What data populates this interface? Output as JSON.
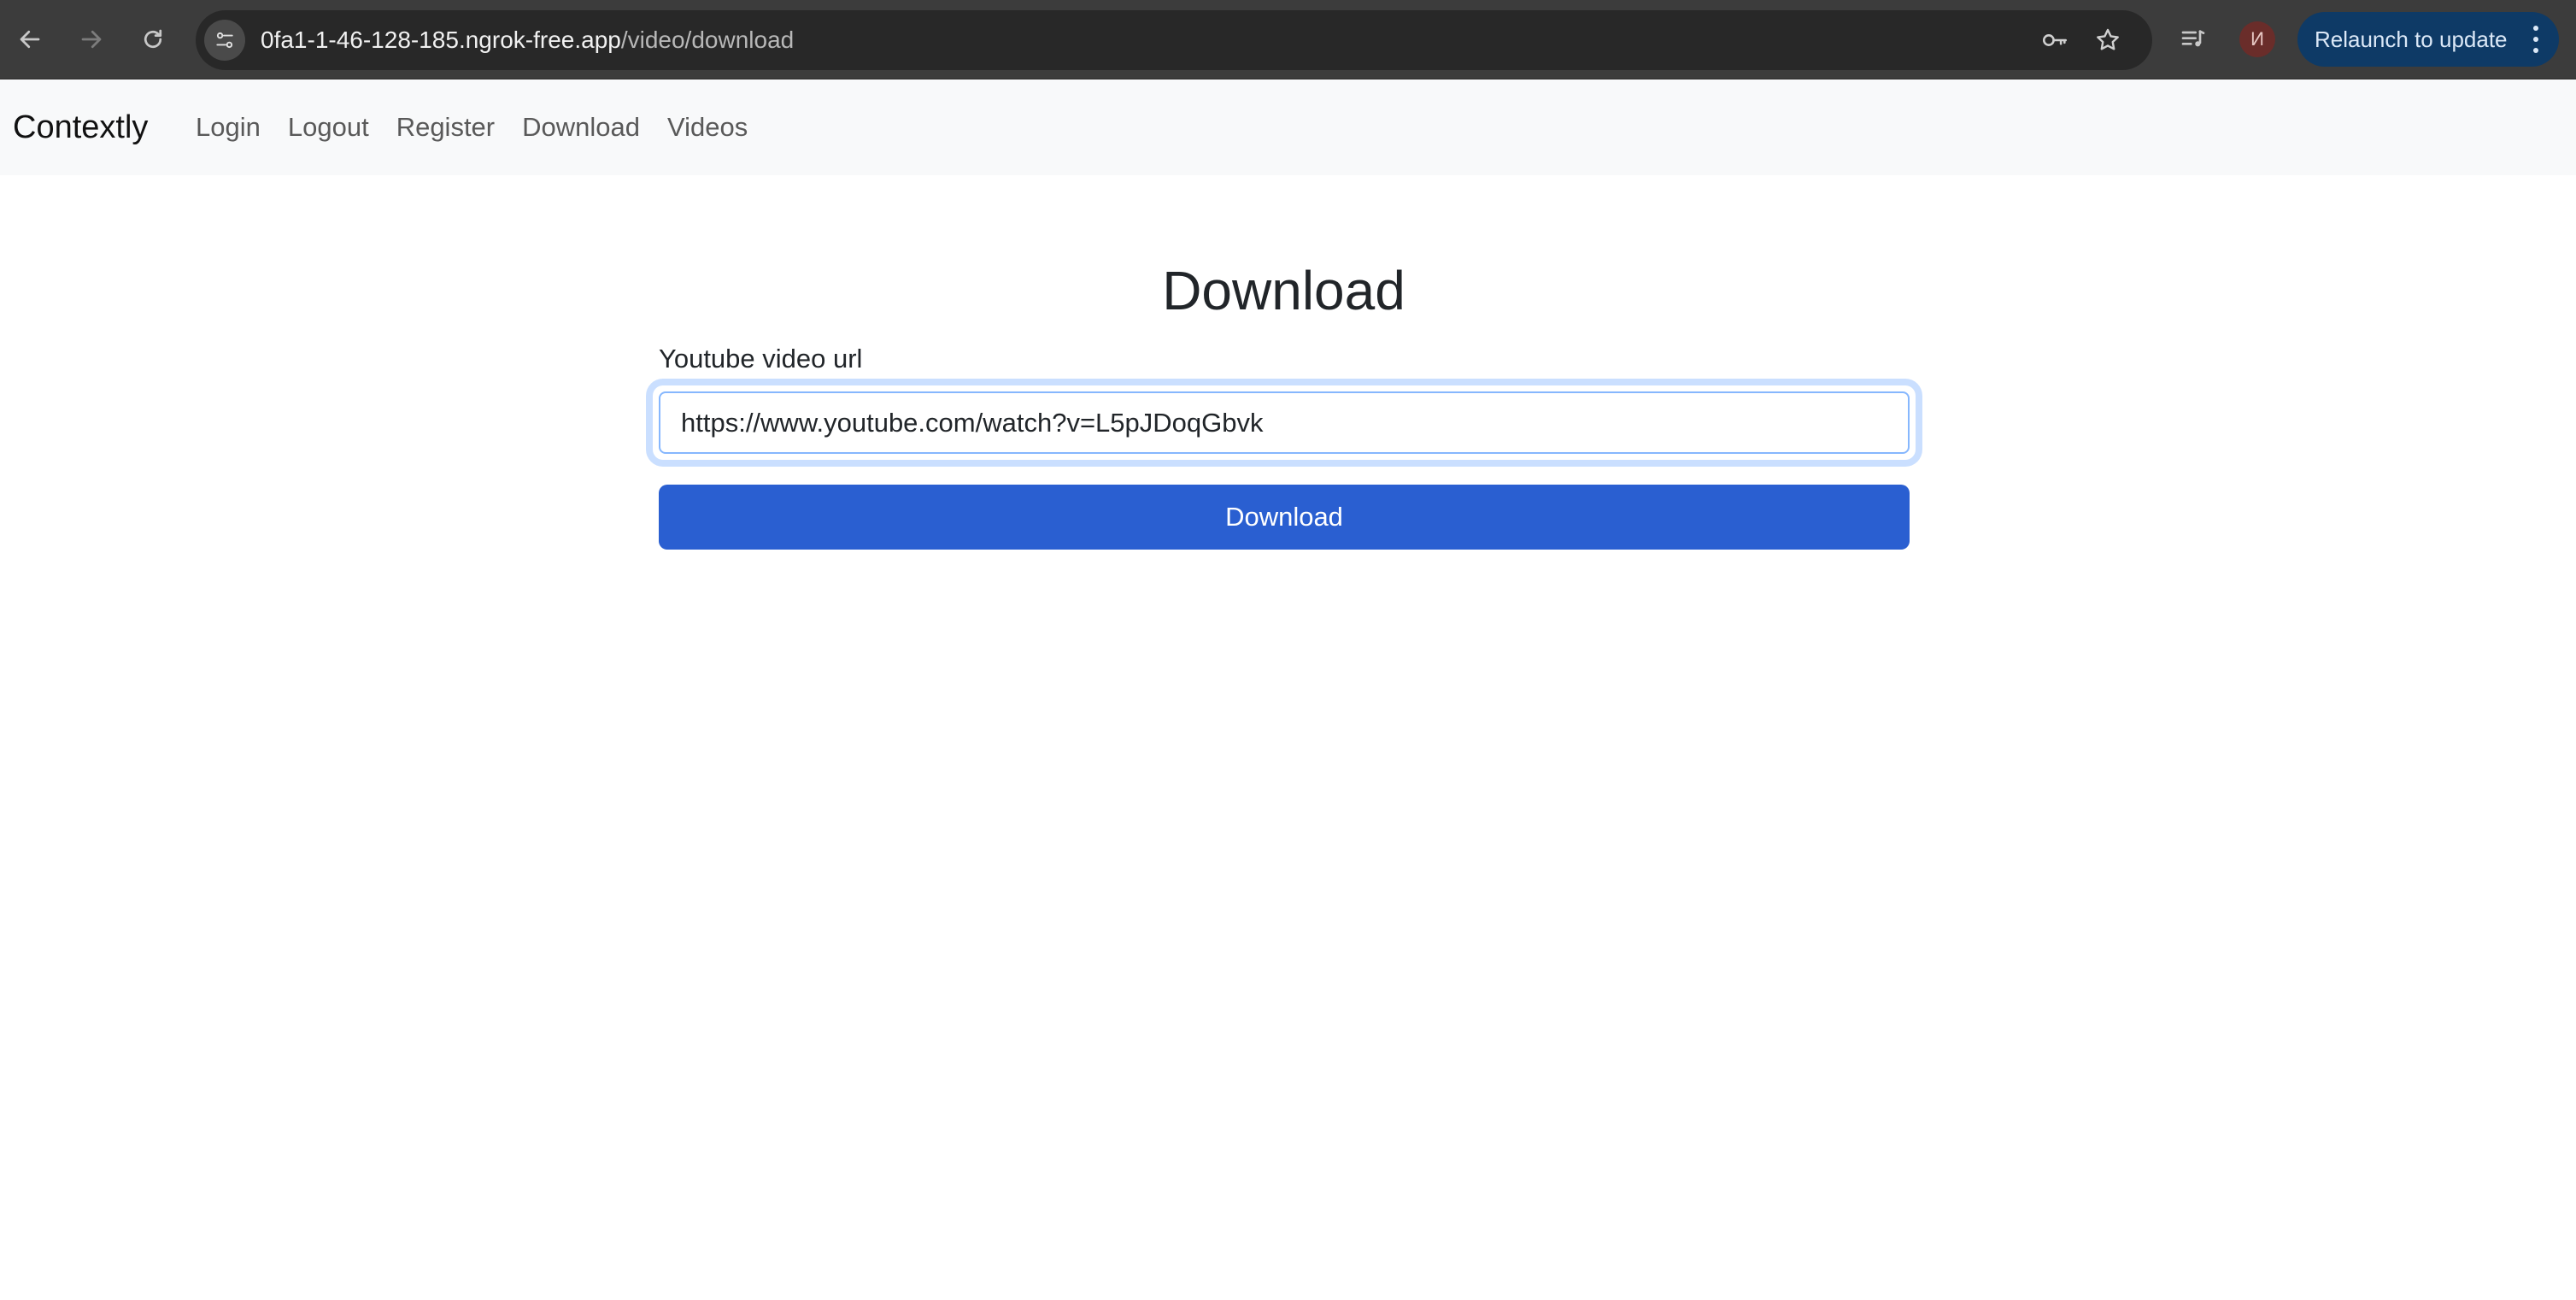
{
  "browser": {
    "url_host": "0fa1-1-46-128-185.ngrok-free.app",
    "url_path": "/video/download",
    "avatar_letter": "И",
    "relaunch_label": "Relaunch to update",
    "icons": {
      "back": "arrow-left-icon",
      "forward": "arrow-right-icon",
      "reload": "reload-icon",
      "site_info": "tune-icon",
      "password": "key-icon",
      "bookmark": "star-icon",
      "media": "media-queue-icon",
      "menu": "kebab-menu-icon"
    }
  },
  "navbar": {
    "brand": "Contextly",
    "links": [
      {
        "label": "Login"
      },
      {
        "label": "Logout"
      },
      {
        "label": "Register"
      },
      {
        "label": "Download"
      },
      {
        "label": "Videos"
      }
    ]
  },
  "form": {
    "title": "Download",
    "url_label": "Youtube video url",
    "url_value": "https://www.youtube.com/watch?v=L5pJDoqGbvk",
    "submit_label": "Download"
  },
  "colors": {
    "primary_button": "#2a5fd1",
    "navbar_bg": "#f8f9fa",
    "chrome_bg": "#3c3c3c",
    "relaunch_bg": "#0e3a66"
  }
}
